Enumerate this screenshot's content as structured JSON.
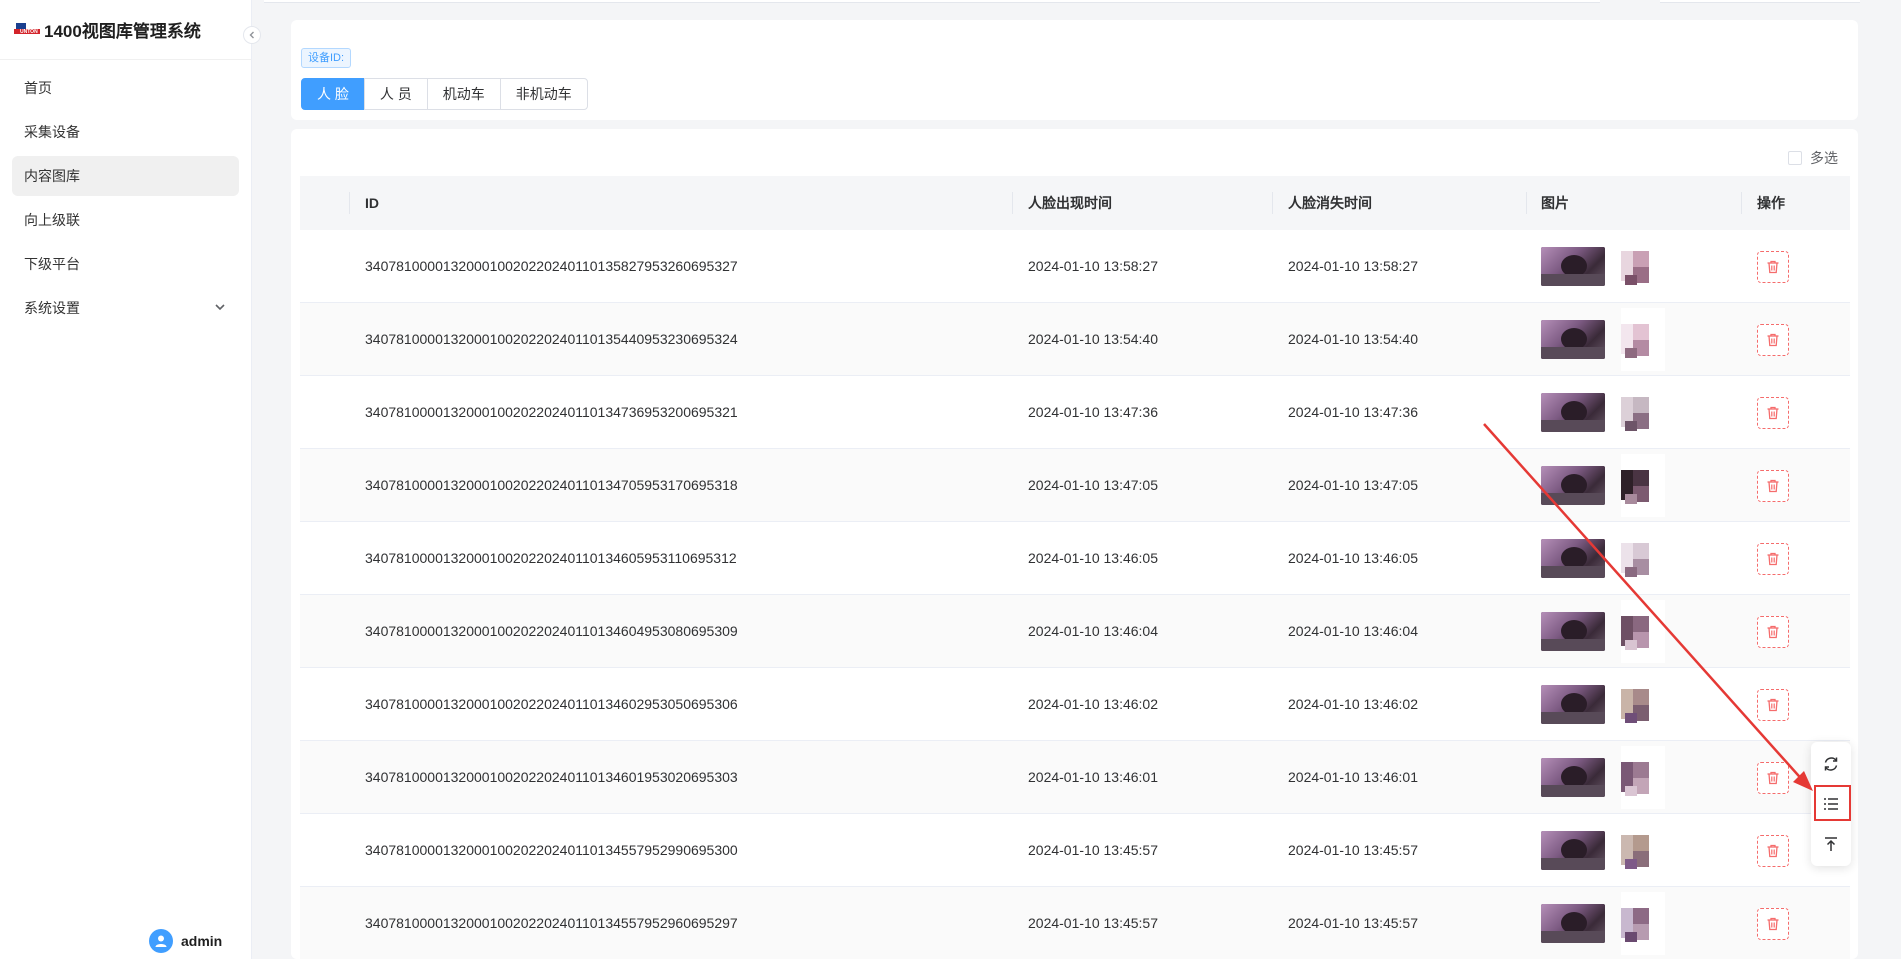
{
  "app": {
    "brand_title": "1400视图库管理系统",
    "logo_text": "UNTON"
  },
  "sidebar": {
    "items": [
      {
        "label": "首页"
      },
      {
        "label": "采集设备"
      },
      {
        "label": "内容图库"
      },
      {
        "label": "向上级联"
      },
      {
        "label": "下级平台"
      },
      {
        "label": "系统设置"
      }
    ],
    "active_index": 2,
    "user_name": "admin"
  },
  "filter": {
    "device_tag": "设备ID:",
    "tabs": [
      "人 脸",
      "人 员",
      "机动车",
      "非机动车"
    ],
    "active_tab": 0
  },
  "table": {
    "multi_select_label": "多选",
    "columns": [
      "ID",
      "人脸出现时间",
      "人脸消失时间",
      "图片",
      "操作"
    ],
    "rows": [
      {
        "id": "340781000013200010020220240110135827953260695327",
        "appear": "2024-01-10 13:58:27",
        "disappear": "2024-01-10 13:58:27"
      },
      {
        "id": "340781000013200010020220240110135440953230695324",
        "appear": "2024-01-10 13:54:40",
        "disappear": "2024-01-10 13:54:40"
      },
      {
        "id": "340781000013200010020220240110134736953200695321",
        "appear": "2024-01-10 13:47:36",
        "disappear": "2024-01-10 13:47:36"
      },
      {
        "id": "340781000013200010020220240110134705953170695318",
        "appear": "2024-01-10 13:47:05",
        "disappear": "2024-01-10 13:47:05"
      },
      {
        "id": "340781000013200010020220240110134605953110695312",
        "appear": "2024-01-10 13:46:05",
        "disappear": "2024-01-10 13:46:05"
      },
      {
        "id": "340781000013200010020220240110134604953080695309",
        "appear": "2024-01-10 13:46:04",
        "disappear": "2024-01-10 13:46:04"
      },
      {
        "id": "340781000013200010020220240110134602953050695306",
        "appear": "2024-01-10 13:46:02",
        "disappear": "2024-01-10 13:46:02"
      },
      {
        "id": "340781000013200010020220240110134601953020695303",
        "appear": "2024-01-10 13:46:01",
        "disappear": "2024-01-10 13:46:01"
      },
      {
        "id": "340781000013200010020220240110134557952990695300",
        "appear": "2024-01-10 13:45:57",
        "disappear": "2024-01-10 13:45:57"
      },
      {
        "id": "340781000013200010020220240110134557952960695297",
        "appear": "2024-01-10 13:45:57",
        "disappear": "2024-01-10 13:45:57"
      }
    ]
  },
  "float_toolbar": {
    "buttons": [
      "refresh-icon",
      "list-icon",
      "back-to-top-icon"
    ],
    "highlighted": "list-icon"
  },
  "colors": {
    "primary": "#409eff",
    "danger": "#f56c6c",
    "annotation": "#e53935"
  }
}
